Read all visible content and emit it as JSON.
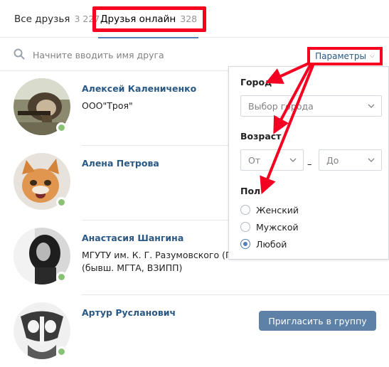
{
  "tabs": {
    "all": {
      "label": "Все друзья",
      "count": "3 227"
    },
    "online": {
      "label": "Друзья онлайн",
      "count": "328"
    }
  },
  "search": {
    "placeholder": "Начните вводить имя друга"
  },
  "params_button": {
    "label": "Параметры"
  },
  "friends": [
    {
      "name": "Алексей Калениченко",
      "subtitle": "ООО\"Троя\"",
      "subtitle2": ""
    },
    {
      "name": "Алена Петрова",
      "subtitle": "",
      "subtitle2": ""
    },
    {
      "name": "Анастасия Шангина",
      "subtitle": "МГУТУ им. К. Г. Разумовского (ПК",
      "subtitle2": "(бывш. МГТА, ВЗИПП)"
    },
    {
      "name": "Артур Русланович",
      "subtitle": "",
      "subtitle2": ""
    }
  ],
  "invite_button": {
    "label": "Пригласить в группу"
  },
  "filter_panel": {
    "city_label": "Город",
    "city_placeholder": "Выбор города",
    "age_label": "Возраст",
    "age_from": "От",
    "age_separator": "–",
    "age_to": "До",
    "sex_label": "Пол",
    "sex_options": [
      {
        "label": "Женский",
        "checked": false
      },
      {
        "label": "Мужской",
        "checked": false
      },
      {
        "label": "Любой",
        "checked": true
      }
    ]
  },
  "colors": {
    "accent": "#5181b8",
    "link": "#2a5885",
    "highlight": "#f60021",
    "online": "#8ac176",
    "button": "#5e81a8"
  }
}
